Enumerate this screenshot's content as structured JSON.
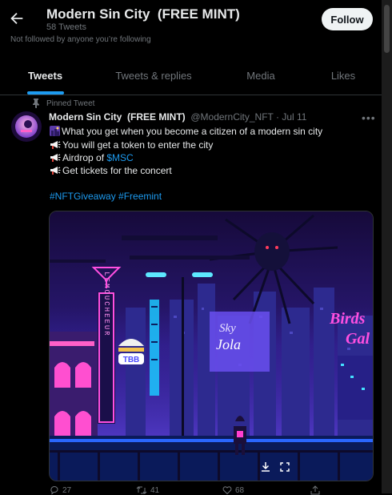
{
  "header": {
    "title": "Modern Sin City  (FREE MINT)",
    "tweet_count": "58 Tweets",
    "not_followed": "Not followed by anyone you’re following",
    "follow_label": "Follow"
  },
  "tabs": [
    {
      "label": "Tweets"
    },
    {
      "label": "Tweets & replies"
    },
    {
      "label": "Media"
    },
    {
      "label": "Likes"
    }
  ],
  "tweet": {
    "pinned_label": "Pinned Tweet",
    "display_name": "Modern Sin City  (FREE MINT)",
    "handle_date": "@ModernCity_NFT · Jul 11",
    "line1": "What you get when you become a citizen of a modern sin city",
    "line2": "You will get a token to enter the city",
    "line3_prefix": "Airdrop of ",
    "line3_link": "$MSC",
    "line4": "Get tickets for the concert",
    "hashtags": "#NFTGiveaway #Freemint",
    "reply_count": "27",
    "retweet_count": "41",
    "like_count": "68"
  },
  "media": {
    "sign_vertical": "LEMOUCHEEUR",
    "burger_sign": "TBB",
    "sign_right_1": "Birds",
    "sign_right_2": "Gal",
    "sign_mid_1": "Sky",
    "sign_mid_2": "Jola"
  },
  "icons": {
    "back": "back-arrow-icon",
    "pin": "pin-icon",
    "more": "more-icon",
    "download": "download-icon",
    "expand": "expand-icon",
    "reply": "reply-icon",
    "retweet": "retweet-icon",
    "like": "like-icon",
    "share": "share-icon"
  },
  "colors": {
    "accent": "#1d9bf0",
    "background": "#000000",
    "neon_pink": "#ff3fd0",
    "neon_cyan": "#37e6ff"
  }
}
